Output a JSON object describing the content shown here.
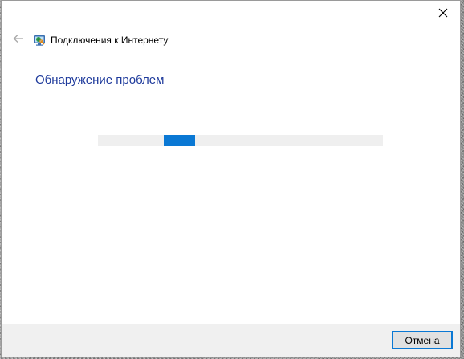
{
  "window": {
    "title": "Подключения к Интернету",
    "heading": "Обнаружение проблем"
  },
  "icons": {
    "close": "close-icon",
    "back": "back-arrow-icon",
    "app": "network-troubleshooter-icon"
  },
  "progress": {
    "state": "indeterminate"
  },
  "footer": {
    "cancel_label": "Отмена"
  },
  "colors": {
    "heading": "#1f3b9c",
    "progress_fill": "#0a78d4",
    "progress_track": "#efefef",
    "button_focus_border": "#0a78d4",
    "footer_bg": "#f0f0f0"
  }
}
